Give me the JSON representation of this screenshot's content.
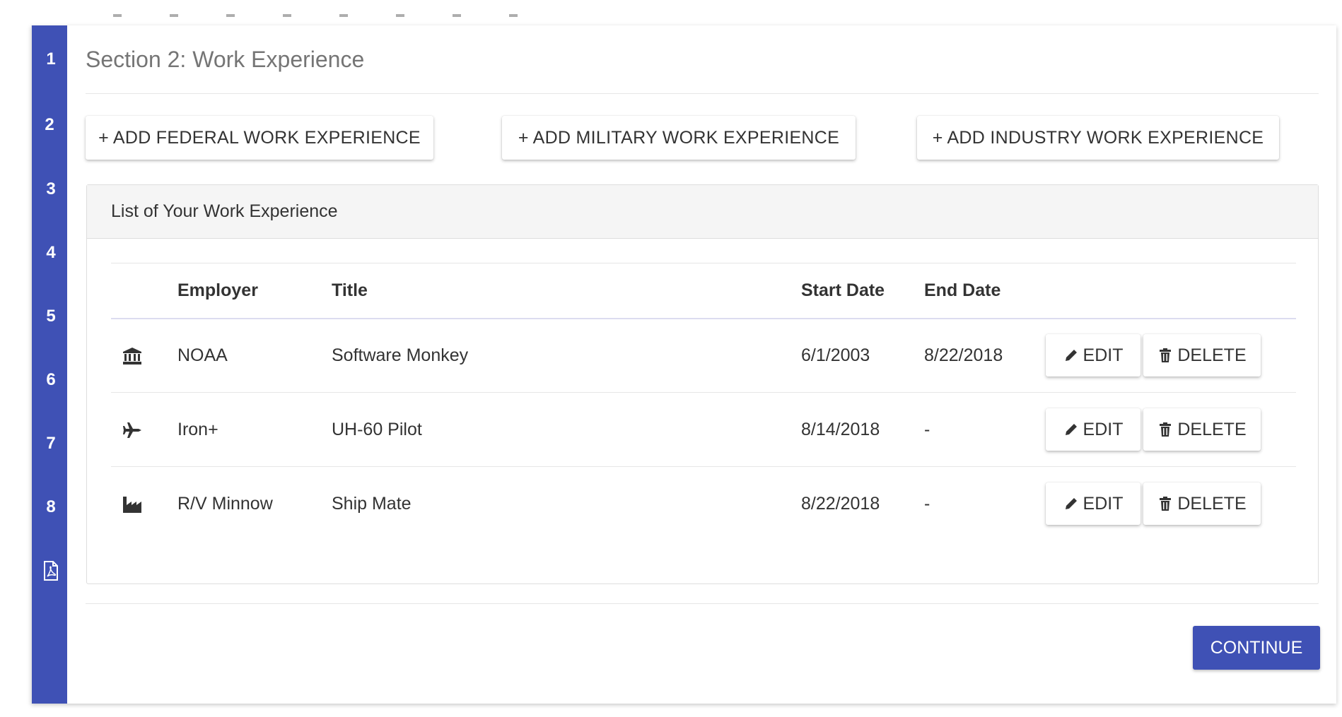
{
  "stepper": {
    "steps": [
      "1",
      "2",
      "3",
      "4",
      "5",
      "6",
      "7",
      "8"
    ],
    "active_step": "2",
    "last_icon": "pdf-icon"
  },
  "section": {
    "title": "Section 2: Work Experience"
  },
  "actions": {
    "add_federal": "+ ADD FEDERAL WORK EXPERIENCE",
    "add_military": "+ ADD MILITARY WORK EXPERIENCE",
    "add_industry": "+ ADD INDUSTRY WORK EXPERIENCE"
  },
  "panel": {
    "heading": "List of Your Work Experience",
    "columns": [
      "",
      "Employer",
      "Title",
      "Start Date",
      "End Date",
      ""
    ],
    "rows": [
      {
        "icon": "bank-icon",
        "employer": "NOAA",
        "title": "Software Monkey",
        "start": "6/1/2003",
        "end": "8/22/2018",
        "edit": "EDIT",
        "delete": "DELETE"
      },
      {
        "icon": "plane-icon",
        "employer": "Iron+",
        "title": "UH-60 Pilot",
        "start": "8/14/2018",
        "end": "-",
        "edit": "EDIT",
        "delete": "DELETE"
      },
      {
        "icon": "factory-icon",
        "employer": "R/V Minnow",
        "title": "Ship Mate",
        "start": "8/22/2018",
        "end": "-",
        "edit": "EDIT",
        "delete": "DELETE"
      }
    ]
  },
  "footer": {
    "continue_label": "CONTINUE"
  },
  "colors": {
    "accent": "#3f51b5",
    "panel_header_bg": "#f5f5f5"
  }
}
